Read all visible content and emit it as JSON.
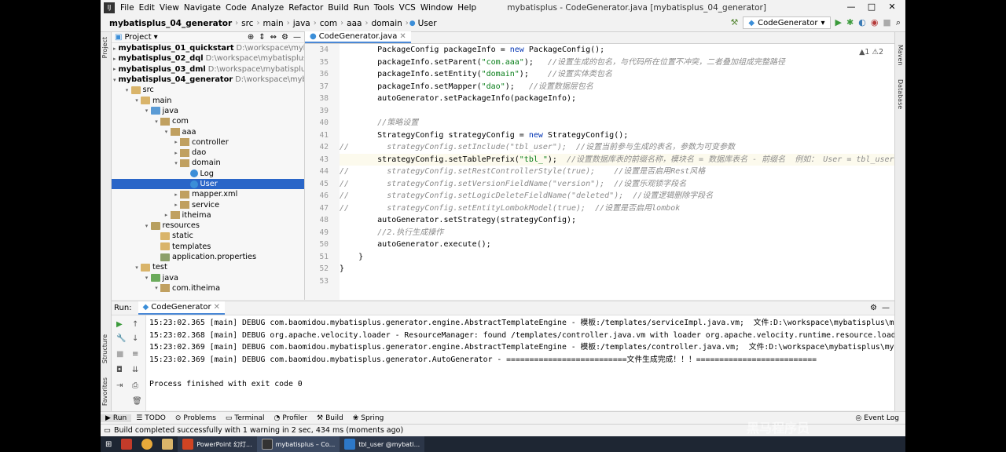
{
  "menubar": {
    "items": [
      "File",
      "Edit",
      "View",
      "Navigate",
      "Code",
      "Analyze",
      "Refactor",
      "Build",
      "Run",
      "Tools",
      "VCS",
      "Window",
      "Help"
    ],
    "title": "mybatisplus - CodeGenerator.java [mybatisplus_04_generator]"
  },
  "breadcrumb": [
    "mybatisplus_04_generator",
    "src",
    "main",
    "java",
    "com",
    "aaa",
    "domain",
    "User"
  ],
  "run_config": "CodeGenerator",
  "project_panel": {
    "title": "Project",
    "tree": [
      {
        "label": "mybatisplus_01_quickstart",
        "path": "D:\\workspace\\mybatisplus\\myb",
        "depth": 0,
        "arrow": "▸",
        "icon": "module",
        "bold": true
      },
      {
        "label": "mybatisplus_02_dql",
        "path": "D:\\workspace\\mybatisplus\\mybatisp",
        "depth": 0,
        "arrow": "▸",
        "icon": "module",
        "bold": true
      },
      {
        "label": "mybatisplus_03_dml",
        "path": "D:\\workspace\\mybatisplus\\mybati",
        "depth": 0,
        "arrow": "▸",
        "icon": "module",
        "bold": true
      },
      {
        "label": "mybatisplus_04_generator",
        "path": "D:\\workspace\\mybatispl",
        "depth": 0,
        "arrow": "▾",
        "icon": "module",
        "bold": true
      },
      {
        "label": "src",
        "path": "",
        "depth": 1,
        "arrow": "▾",
        "icon": "folder",
        "bold": false
      },
      {
        "label": "main",
        "path": "",
        "depth": 2,
        "arrow": "▾",
        "icon": "folder",
        "bold": false
      },
      {
        "label": "java",
        "path": "",
        "depth": 3,
        "arrow": "▾",
        "icon": "src",
        "bold": false
      },
      {
        "label": "com",
        "path": "",
        "depth": 4,
        "arrow": "▾",
        "icon": "pkg",
        "bold": false
      },
      {
        "label": "aaa",
        "path": "",
        "depth": 5,
        "arrow": "▾",
        "icon": "pkg",
        "bold": false
      },
      {
        "label": "controller",
        "path": "",
        "depth": 6,
        "arrow": "▸",
        "icon": "pkg",
        "bold": false
      },
      {
        "label": "dao",
        "path": "",
        "depth": 6,
        "arrow": "▸",
        "icon": "pkg",
        "bold": false
      },
      {
        "label": "domain",
        "path": "",
        "depth": 6,
        "arrow": "▾",
        "icon": "pkg",
        "bold": false
      },
      {
        "label": "Log",
        "path": "",
        "depth": 7,
        "arrow": "",
        "icon": "cls",
        "bold": false
      },
      {
        "label": "User",
        "path": "",
        "depth": 7,
        "arrow": "",
        "icon": "cls",
        "bold": false,
        "selected": true
      },
      {
        "label": "mapper.xml",
        "path": "",
        "depth": 6,
        "arrow": "▸",
        "icon": "pkg",
        "bold": false
      },
      {
        "label": "service",
        "path": "",
        "depth": 6,
        "arrow": "▸",
        "icon": "pkg",
        "bold": false
      },
      {
        "label": "itheima",
        "path": "",
        "depth": 5,
        "arrow": "▸",
        "icon": "pkg",
        "bold": false
      },
      {
        "label": "resources",
        "path": "",
        "depth": 3,
        "arrow": "▾",
        "icon": "res",
        "bold": false
      },
      {
        "label": "static",
        "path": "",
        "depth": 4,
        "arrow": "",
        "icon": "folder",
        "bold": false
      },
      {
        "label": "templates",
        "path": "",
        "depth": 4,
        "arrow": "",
        "icon": "folder",
        "bold": false
      },
      {
        "label": "application.properties",
        "path": "",
        "depth": 4,
        "arrow": "",
        "icon": "props",
        "bold": false
      },
      {
        "label": "test",
        "path": "",
        "depth": 2,
        "arrow": "▾",
        "icon": "folder",
        "bold": false
      },
      {
        "label": "java",
        "path": "",
        "depth": 3,
        "arrow": "▾",
        "icon": "test",
        "bold": false
      },
      {
        "label": "com.itheima",
        "path": "",
        "depth": 4,
        "arrow": "▾",
        "icon": "pkg",
        "bold": false
      }
    ]
  },
  "editor": {
    "tab": "CodeGenerator.java",
    "hint": "▲1 ⚠2",
    "lines": [
      {
        "n": "34",
        "segs": [
          [
            "",
            "        PackageConfig packageInfo = "
          ],
          [
            "kw",
            "new"
          ],
          [
            "",
            " PackageConfig();"
          ]
        ]
      },
      {
        "n": "35",
        "segs": [
          [
            "",
            "        packageInfo.setParent("
          ],
          [
            "str",
            "\"com.aaa\""
          ],
          [
            "",
            ");   "
          ],
          [
            "comment",
            "//设置生成的包名，与代码所在位置不冲突，二者叠加组成完整路径"
          ]
        ]
      },
      {
        "n": "36",
        "segs": [
          [
            "",
            "        packageInfo.setEntity("
          ],
          [
            "str",
            "\"domain\""
          ],
          [
            "",
            ");    "
          ],
          [
            "comment",
            "//设置实体类包名"
          ]
        ]
      },
      {
        "n": "37",
        "segs": [
          [
            "",
            "        packageInfo.setMapper("
          ],
          [
            "str",
            "\"dao\""
          ],
          [
            "",
            ");   "
          ],
          [
            "comment",
            "//设置数据层包名"
          ]
        ]
      },
      {
        "n": "38",
        "segs": [
          [
            "",
            "        autoGenerator.setPackageInfo(packageInfo);"
          ]
        ]
      },
      {
        "n": "39",
        "segs": [
          [
            "",
            ""
          ]
        ]
      },
      {
        "n": "40",
        "segs": [
          [
            "comment",
            "        //策略设置"
          ]
        ]
      },
      {
        "n": "41",
        "segs": [
          [
            "",
            "        StrategyConfig strategyConfig = "
          ],
          [
            "kw",
            "new"
          ],
          [
            "",
            " StrategyConfig();"
          ]
        ]
      },
      {
        "n": "42",
        "segs": [
          [
            "comment",
            "//        strategyConfig.setInclude(\"tbl_user\");  //设置当前参与生成的表名，参数为可变参数"
          ]
        ]
      },
      {
        "n": "43",
        "segs": [
          [
            "",
            "        strategyConfig.setTablePrefix("
          ],
          [
            "str",
            "\"tbl_\""
          ],
          [
            "",
            ");  "
          ],
          [
            "comment",
            "//设置数据库表的前缀名称，模块名 = 数据库表名 - 前缀名  例如： User = tbl_user"
          ]
        ],
        "current": true
      },
      {
        "n": "44",
        "segs": [
          [
            "comment",
            "//        strategyConfig.setRestControllerStyle(true);    //设置是否启用Rest风格"
          ]
        ]
      },
      {
        "n": "45",
        "segs": [
          [
            "comment",
            "//        strategyConfig.setVersionFieldName(\"version\");  //设置乐观锁字段名"
          ]
        ]
      },
      {
        "n": "46",
        "segs": [
          [
            "comment",
            "//        strategyConfig.setLogicDeleteFieldName(\"deleted\");  //设置逻辑删除字段名"
          ]
        ]
      },
      {
        "n": "47",
        "segs": [
          [
            "comment",
            "//        strategyConfig.setEntityLombokModel(true);  //设置是否启用lombok"
          ]
        ]
      },
      {
        "n": "48",
        "segs": [
          [
            "",
            "        autoGenerator.setStrategy(strategyConfig);"
          ]
        ]
      },
      {
        "n": "49",
        "segs": [
          [
            "comment",
            "        //2.执行生成操作"
          ]
        ]
      },
      {
        "n": "50",
        "segs": [
          [
            "",
            "        autoGenerator.execute();"
          ]
        ]
      },
      {
        "n": "51",
        "segs": [
          [
            "",
            "    }"
          ]
        ]
      },
      {
        "n": "52",
        "segs": [
          [
            "",
            "}"
          ]
        ]
      },
      {
        "n": "53",
        "segs": [
          [
            "",
            ""
          ]
        ]
      }
    ]
  },
  "run_panel": {
    "label": "Run:",
    "tab": "CodeGenerator",
    "console": [
      "15:23:02.365 [main] DEBUG com.baomidou.mybatisplus.generator.engine.AbstractTemplateEngine - 模板:/templates/serviceImpl.java.vm;  文件:D:\\workspace\\mybatisplus\\my",
      "15:23:02.368 [main] DEBUG org.apache.velocity.loader - ResourceManager: found /templates/controller.java.vm with loader org.apache.velocity.runtime.resource.loade",
      "15:23:02.369 [main] DEBUG com.baomidou.mybatisplus.generator.engine.AbstractTemplateEngine - 模板:/templates/controller.java.vm;  文件:D:\\workspace\\mybatisplus\\myb",
      "15:23:02.369 [main] DEBUG com.baomidou.mybatisplus.generator.AutoGenerator - ==========================文件生成完成！！！==========================",
      "",
      "Process finished with exit code 0"
    ]
  },
  "bottom_tabs": [
    "Run",
    "TODO",
    "Problems",
    "Terminal",
    "Profiler",
    "Build",
    "Spring"
  ],
  "event_log": "Event Log",
  "status": "Build completed successfully with 1 warning in 2 sec, 434 ms (moments ago)",
  "side_labels": {
    "project": "Project",
    "structure": "Structure",
    "favorites": "Favorites",
    "maven": "Maven",
    "database": "Database"
  },
  "taskbar": {
    "powerpoint": "PowerPoint 幻灯...",
    "idea": "mybatisplus – Co...",
    "db": "tbl_user @mybati..."
  },
  "watermark": "黑马程序员"
}
